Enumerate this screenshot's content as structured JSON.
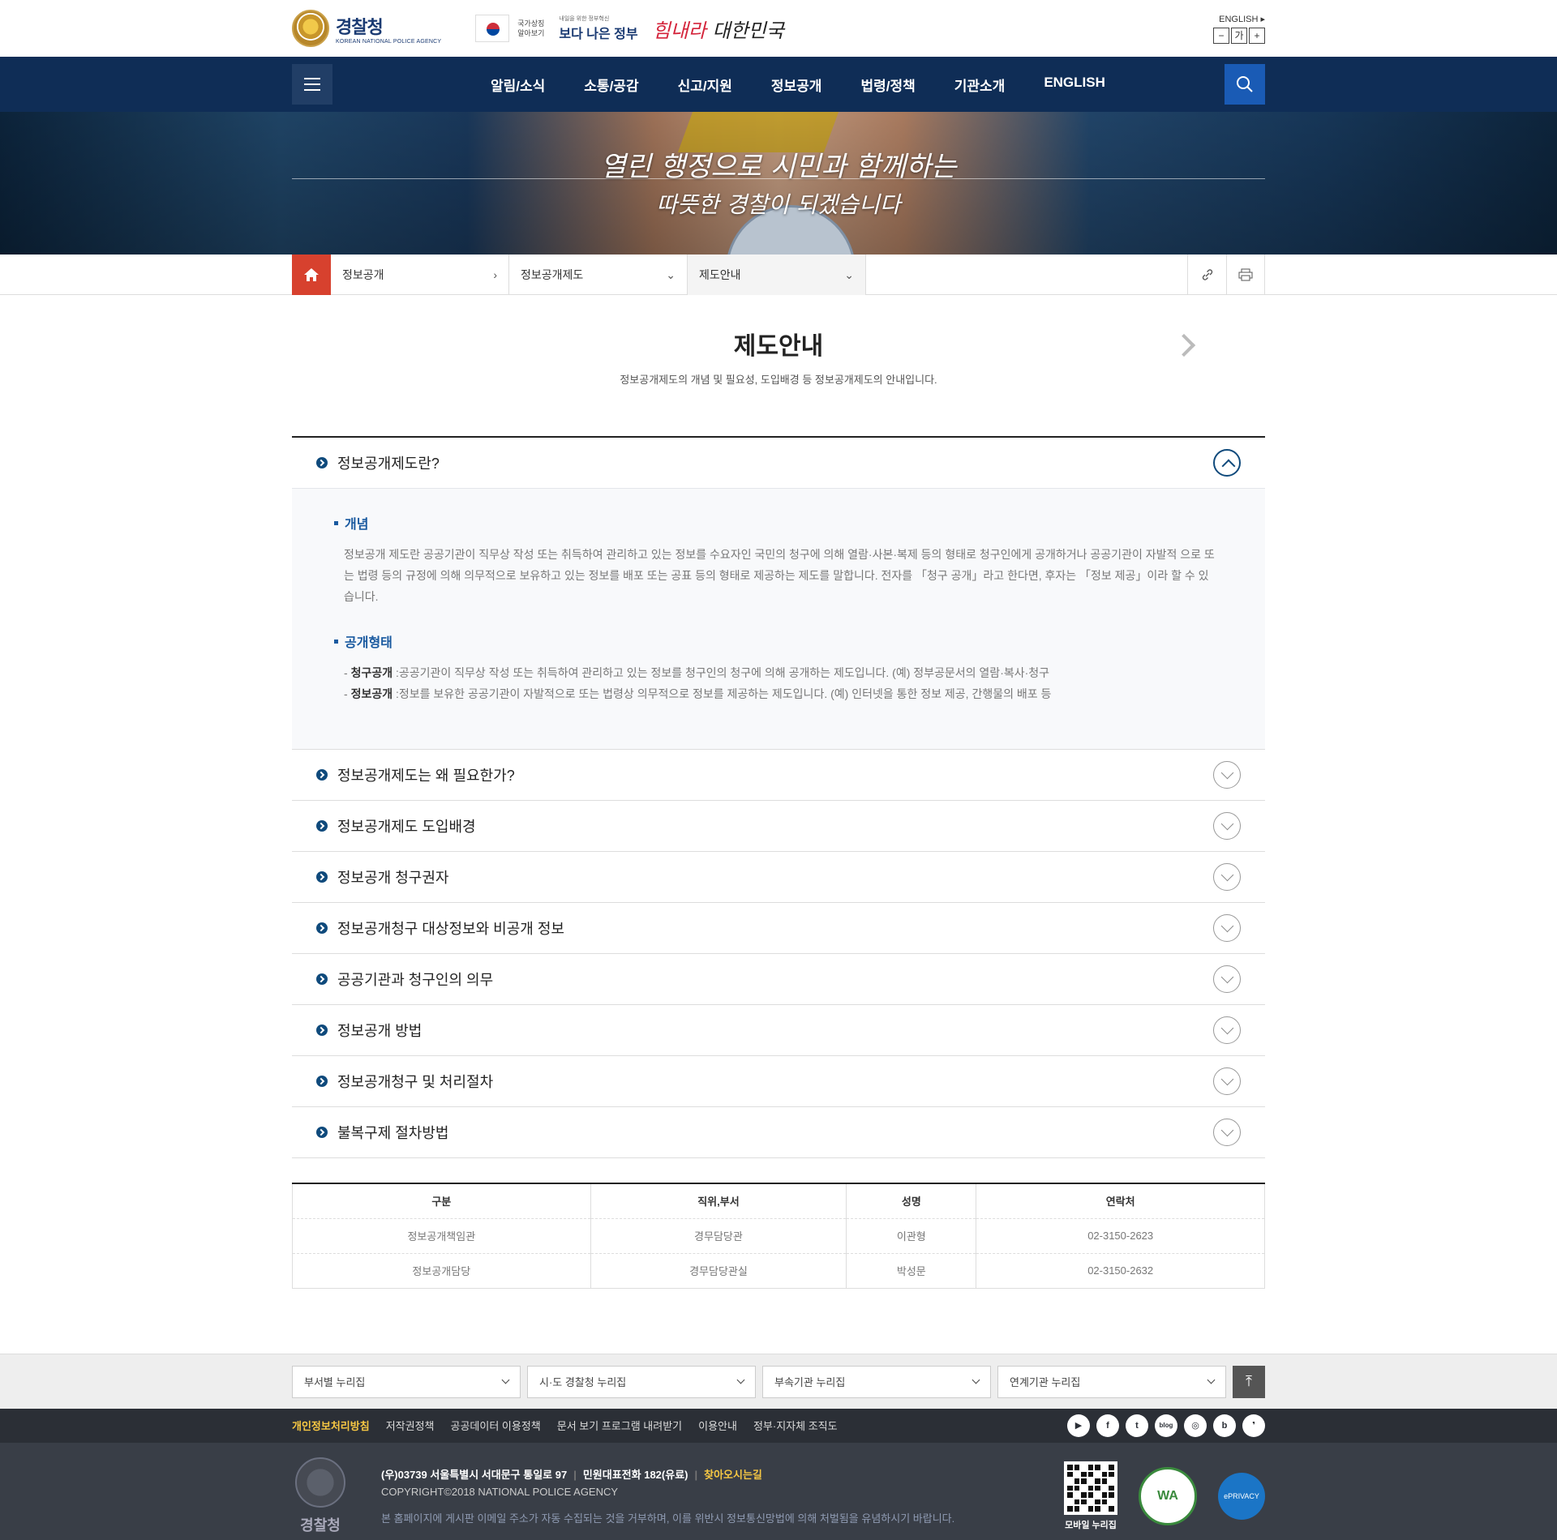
{
  "header": {
    "logo_ko": "경찰청",
    "logo_en": "KOREAN NATIONAL POLICE AGENCY",
    "flag_text_1": "국가상징",
    "flag_text_2": "알아보기",
    "better_gov_small": "내일을 위한 정부혁신",
    "better_gov_big": "보다 나은 정부",
    "slogan_a": "힘내라",
    "slogan_b": " 대한민국",
    "english_link": "ENGLISH",
    "zoom_out": "−",
    "zoom_ga": "가",
    "zoom_in": "+"
  },
  "gnb": {
    "items": [
      "알림/소식",
      "소통/공감",
      "신고/지원",
      "정보공개",
      "법령/정책",
      "기관소개",
      "ENGLISH"
    ]
  },
  "visual": {
    "line1": "열린 행정으로 시민과 함께하는",
    "line2": "따뜻한 경찰이 되겠습니다"
  },
  "location": {
    "crumbs": [
      "정보공개",
      "정보공개제도",
      "제도안내"
    ]
  },
  "page": {
    "title": "제도안내",
    "description": "정보공개제도의 개념 및 필요성, 도입배경 등 정보공개제도의 안내입니다."
  },
  "accordion": {
    "open_title": "정보공개제도란?",
    "concept_heading": "개념",
    "concept_text": "정보공개 제도란 공공기관이 직무상 작성 또는 취득하여 관리하고 있는 정보를 수요자인 국민의 청구에 의해 열람·사본·복제 등의 형태로 청구인에게 공개하거나 공공기관이 자발적 으로 또는 법령 등의 규정에 의해 의무적으로 보유하고 있는 정보를 배포 또는 공표 등의 형태로 제공하는 제도를 말합니다. 전자를 「청구 공개」라고 한다면, 후자는 「정보 제공」이라 할 수 있습니다.",
    "forms_heading": "공개형태",
    "form1_label": "청구공개",
    "form1_text": " :공공기관이 직무상 작성 또는 취득하여 관리하고 있는 정보를 청구인의 청구에 의해 공개하는 제도입니다. (예) 정부공문서의 열람·복사·청구",
    "form2_label": "정보공개",
    "form2_text": " :정보를 보유한 공공기관이 자발적으로 또는 법령상 의무적으로 정보를 제공하는 제도입니다. (예) 인터넷을 통한 정보 제공, 간행물의 배포 등",
    "items": [
      "정보공개제도는 왜 필요한가?",
      "정보공개제도 도입배경",
      "정보공개 청구권자",
      "정보공개청구 대상정보와 비공개 정보",
      "공공기관과 청구인의 의무",
      "정보공개 방법",
      "정보공개청구 및 처리절차",
      "불복구제 절차방법"
    ]
  },
  "contact_table": {
    "headers": [
      "구분",
      "직위,부서",
      "성명",
      "연락처"
    ],
    "rows": [
      [
        "정보공개책임관",
        "경무담당관",
        "이관형",
        "02-3150-2623"
      ],
      [
        "정보공개담당",
        "경무담당관실",
        "박성문",
        "02-3150-2632"
      ]
    ]
  },
  "footer": {
    "family_sites": [
      "부서별 누리집",
      "시·도 경찰청 누리집",
      "부속기관 누리집",
      "연계기관 누리집"
    ],
    "links": [
      "개인정보처리방침",
      "저작권정책",
      "공공데이터 이용정책",
      "문서 보기 프로그램 내려받기",
      "이용안내",
      "정부·지자체 조직도"
    ],
    "sns": [
      "▶",
      "f",
      "t",
      "blog",
      "◎",
      "b",
      "❜"
    ],
    "logo_text": "경찰청",
    "address": "(우)03739 서울특별시 서대문구 통일로 97",
    "phone": "민원대표전화 182(유료)",
    "directions": "찾아오시는길",
    "copyright": "COPYRIGHT©2018 NATIONAL POLICE AGENCY",
    "notice": "본 홈페이지에 게시판 이메일 주소가 자동 수집되는 것을 거부하며, 이를 위반시 정보통신망법에 의해 처벌됨을 유념하시기 바랍니다.",
    "qr_label": "모바일 누리집",
    "wa_label": "WA",
    "eprivacy_label": "ePRIVACY"
  }
}
